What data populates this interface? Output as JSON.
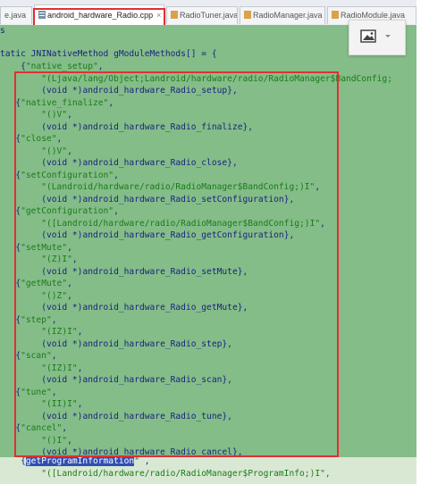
{
  "tabs": [
    {
      "label": "e.java",
      "active": false
    },
    {
      "label": "android_hardware_Radio.cpp",
      "active": true
    },
    {
      "label": "RadioTuner.java",
      "active": false
    },
    {
      "label": "RadioManager.java",
      "active": false
    },
    {
      "label": "RadioModule.java",
      "active": false
    }
  ],
  "code": {
    "line0": "s",
    "decl_kw": "tatic",
    "decl_rest": " JNINativeMethod gModuleMethods[] = {",
    "methods": [
      {
        "name": "\"native_setup\"",
        "sig": "\"(Ljava/lang/Object;Landroid/hardware/radio/RadioManager$BandConfig;",
        "fn": "android_hardware_Radio_setup},"
      },
      {
        "name": "\"native_finalize\"",
        "sig": "\"()V\"",
        "fn": "android_hardware_Radio_finalize},"
      },
      {
        "name": "\"close\"",
        "sig": "\"()V\"",
        "fn": "android_hardware_Radio_close},"
      },
      {
        "name": "\"setConfiguration\"",
        "sig": "\"(Landroid/hardware/radio/RadioManager$BandConfig;)I\"",
        "fn": "android_hardware_Radio_setConfiguration},"
      },
      {
        "name": "\"getConfiguration\"",
        "sig": "\"([Landroid/hardware/radio/RadioManager$BandConfig;)I\"",
        "fn": "android_hardware_Radio_getConfiguration},"
      },
      {
        "name": "\"setMute\"",
        "sig": "\"(Z)I\"",
        "fn": "android_hardware_Radio_setMute},"
      },
      {
        "name": "\"getMute\"",
        "sig": "\"()Z\"",
        "fn": "android_hardware_Radio_getMute},"
      },
      {
        "name": "\"step\"",
        "sig": "\"(IZ)I\"",
        "fn": "android_hardware_Radio_step},"
      },
      {
        "name": "\"scan\"",
        "sig": "\"(IZ)I\"",
        "fn": "android_hardware_Radio_scan},"
      },
      {
        "name": "\"tune\"",
        "sig": "\"(II)I\"",
        "fn": "android_hardware_Radio_tune},"
      },
      {
        "name": "\"cancel\"",
        "sig": "\"()I\"",
        "fn": "android_hardware_Radio_cancel},"
      }
    ],
    "void_cast": "(void *)",
    "last_name": "getProgramInformation",
    "last_sig": "\"([Landroid/hardware/radio/RadioManager$ProgramInfo;)I\","
  },
  "colors": {
    "editor_bg": "#84bd88",
    "highlight": "#e03030",
    "selection": "#2f4fb2"
  }
}
